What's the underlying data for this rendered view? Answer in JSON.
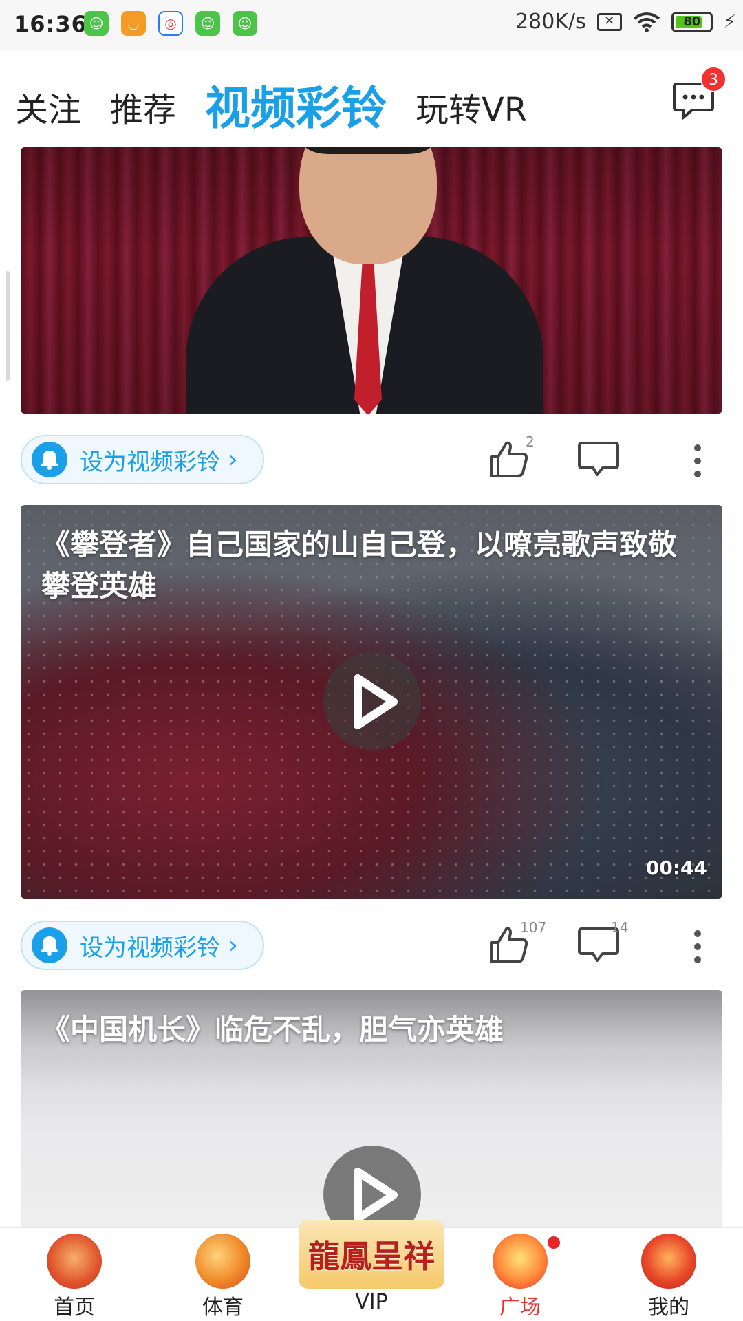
{
  "status_bar": {
    "time": "16:36",
    "network_speed": "280K/s",
    "battery_level": "80",
    "battery_percent": 80,
    "app_icons": [
      "wechat-like-icon",
      "smile-icon",
      "browser-icon",
      "wechat-like-icon",
      "wechat-like-icon"
    ]
  },
  "top_nav": {
    "tabs": [
      {
        "label": "关注",
        "active": false
      },
      {
        "label": "推荐",
        "active": false
      },
      {
        "label": "视频彩铃",
        "active": true
      },
      {
        "label": "玩转VR",
        "active": false
      }
    ],
    "message_badge": "3"
  },
  "feed": {
    "items": [
      {
        "title": "",
        "ring_label": "设为视频彩铃",
        "likes": "2",
        "comments": ""
      },
      {
        "title": "《攀登者》自己国家的山自己登，以嘹亮歌声致敬攀登英雄",
        "duration": "00:44",
        "ring_label": "设为视频彩铃",
        "likes": "107",
        "comments": "14"
      },
      {
        "title": "《中国机长》临危不乱，胆气亦英雄"
      }
    ]
  },
  "bottom_nav": {
    "items": [
      {
        "label": "首页",
        "active": false
      },
      {
        "label": "体育",
        "active": false
      },
      {
        "label": "VIP",
        "active": false,
        "logo_text": "龍鳳呈祥"
      },
      {
        "label": "广场",
        "active": true
      },
      {
        "label": "我的",
        "active": false
      }
    ]
  },
  "colors": {
    "accent": "#1aa0e8",
    "badge_red": "#f23232",
    "active_nav": "#e4322e"
  }
}
